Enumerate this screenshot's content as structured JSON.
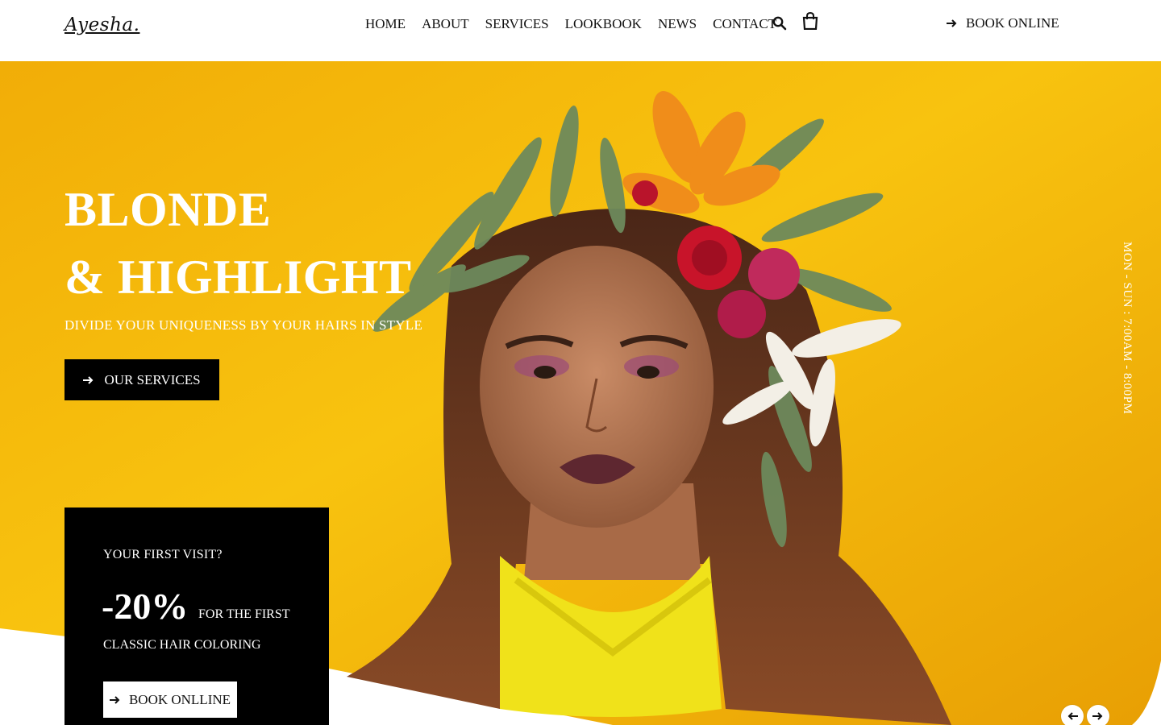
{
  "brand": {
    "logo_text": "Ayesha."
  },
  "nav": {
    "items": [
      {
        "label": "HOME"
      },
      {
        "label": "ABOUT"
      },
      {
        "label": "SERVICES"
      },
      {
        "label": "LOOKBOOK"
      },
      {
        "label": "NEWS"
      },
      {
        "label": "CONTACT"
      }
    ],
    "search_icon": "search-icon",
    "cart_icon": "shopping-bag-icon",
    "book_online_label": "BOOK ONLINE"
  },
  "hero": {
    "title_line1": "BLONDE",
    "title_line2": "& HIGHLIGHT",
    "subtitle": "DIVIDE YOUR UNIQUENESS BY YOUR HAIRS IN STYLE",
    "cta_label": "OUR SERVICES",
    "hours": "MON - SUN : 7:00AM - 8:00PM",
    "background_color": "#f6b800"
  },
  "promo": {
    "question": "YOUR FIRST VISIT?",
    "discount": "-20%",
    "discount_note": "FOR THE FIRST",
    "line2": "CLASSIC HAIR COLORING",
    "cta_label": "BOOK ONLLINE"
  },
  "slider": {
    "prev_icon": "arrow-left-icon",
    "next_icon": "arrow-right-icon"
  }
}
